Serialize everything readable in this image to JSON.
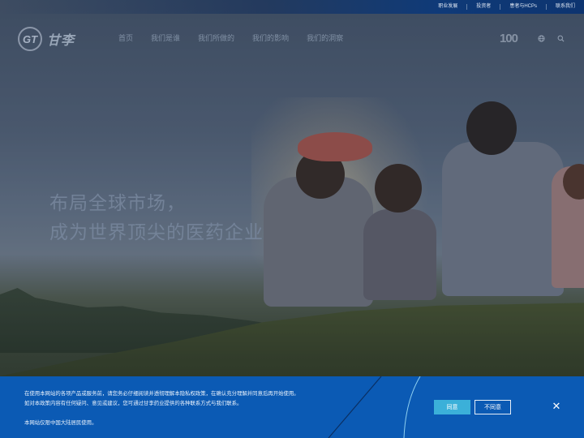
{
  "topbar": {
    "links": [
      "职业发展",
      "投资者",
      "患者与HCPs",
      "联系我们"
    ]
  },
  "brand": {
    "mark": "GT",
    "name": "甘李",
    "centennial": "100"
  },
  "nav": {
    "items": [
      "首页",
      "我们是谁",
      "我们所做的",
      "我们的影响",
      "我们的洞察"
    ],
    "icons": [
      "globe-icon",
      "search-icon"
    ]
  },
  "hero": {
    "slogan_line1": "布局全球市场，",
    "slogan_line2": "成为世界顶尖的医药企业"
  },
  "privacy_banner": {
    "line1": "在使用本网站的各项产品或服务前，请您务必仔细阅读并透彻理解本隐私权政策，在确认充分理解并同意后再开始使用。",
    "line2": "如对本政策内容有任何疑问、意见或建议，您可通过甘李药业提供的各种联系方式与我们联系。",
    "line3": "本网站仅限中国大陆居民使用。",
    "agree_label": "同意",
    "disagree_label": "不同意",
    "close_symbol": "✕",
    "colors": {
      "background": "#0b5ab4",
      "agree_button": "#3bb0d9"
    }
  }
}
